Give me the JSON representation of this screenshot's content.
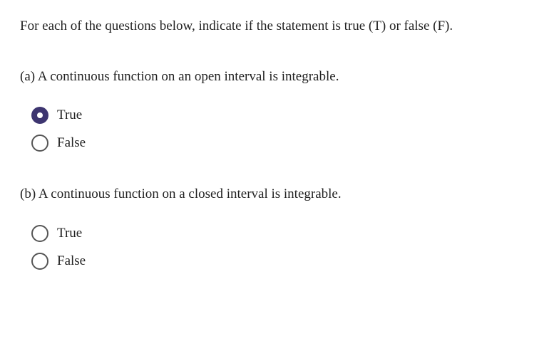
{
  "instructions": "For each of the questions below, indicate if the statement is true (T) or false (F).",
  "questions": [
    {
      "label": "(a) A continuous function on an open interval is integrable.",
      "options": [
        "True",
        "False"
      ],
      "selected": 0
    },
    {
      "label": "(b) A continuous function on a closed interval is integrable.",
      "options": [
        "True",
        "False"
      ],
      "selected": null
    }
  ]
}
